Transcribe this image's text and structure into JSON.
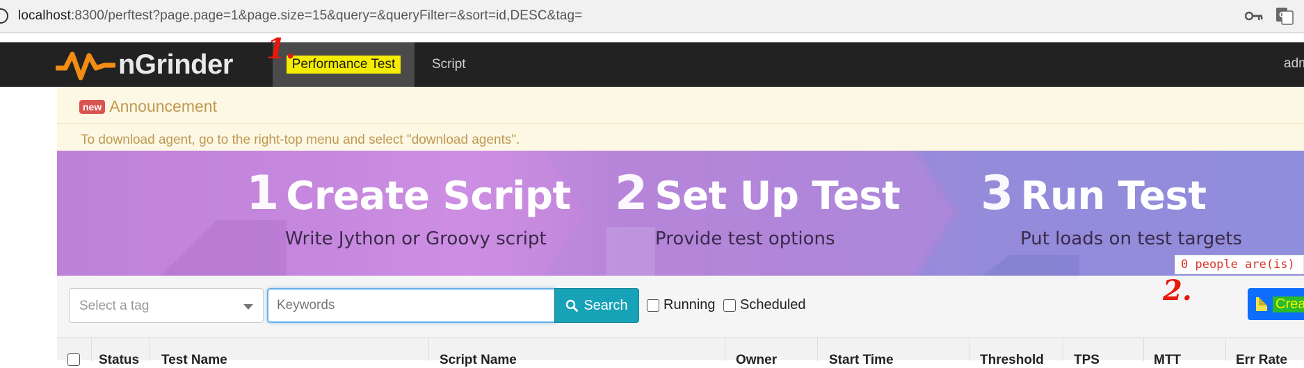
{
  "browser": {
    "url_host": "localhost",
    "url_rest": ":8300/perftest?page.page=1&page.size=15&query=&queryFilter=&sort=id,DESC&tag=",
    "icons": [
      "key-icon",
      "translate-icon"
    ]
  },
  "navbar": {
    "logo_text": "nGrinder",
    "tabs": [
      {
        "label": "Performance Test",
        "active": true
      },
      {
        "label": "Script",
        "active": false
      }
    ],
    "user": "adm",
    "annotation": "1."
  },
  "announcement": {
    "badge": "new",
    "title": "Announcement",
    "body": "To download agent, go to the right-top menu and select \"download agents\"."
  },
  "banner": {
    "steps": [
      {
        "num": "1",
        "title": "Create Script",
        "subtitle": "Write Jython or Groovy script"
      },
      {
        "num": "2",
        "title": "Set Up Test",
        "subtitle": "Provide test options"
      },
      {
        "num": "3",
        "title": "Run Test",
        "subtitle": "Put loads on test targets"
      }
    ]
  },
  "toolbar": {
    "tag_placeholder": "Select a tag",
    "keyword_placeholder": "Keywords",
    "search_label": "Search",
    "running_label": "Running",
    "scheduled_label": "Scheduled",
    "create_label": "Create Test",
    "annotation": "2.",
    "people_text": "0 people are(is)"
  },
  "table": {
    "columns": [
      "Status",
      "Test Name",
      "Script Name",
      "Owner",
      "Start Time",
      "Threshold",
      "TPS",
      "MTT",
      "Err Rate"
    ]
  },
  "colors": {
    "navbar": "#222222",
    "announcement_bg": "#fcf8e3",
    "search_button": "#17a2b8",
    "create_button": "#0d6efd",
    "annotation_red": "#e8180c"
  }
}
